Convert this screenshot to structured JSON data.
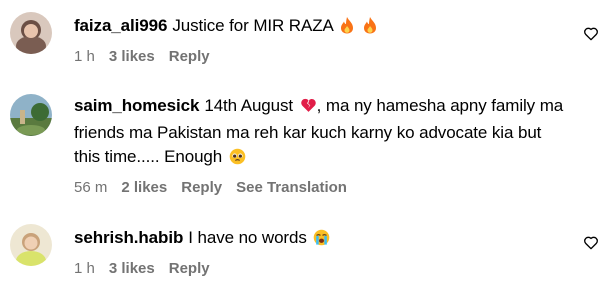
{
  "comments": [
    {
      "username": "faiza_ali996",
      "text": "Justice for MIR RAZA",
      "emojis": [
        "fire-emoji",
        "fire-emoji"
      ],
      "time": "1 h",
      "likes": "3 likes",
      "reply": "Reply"
    },
    {
      "username": "saim_homesick",
      "text_part1": "14th August",
      "text_part2": ", ma ny hamesha apny family ma friends ma Pakistan ma reh kar kuch karny ko advocate kia but this time..... Enough",
      "emojis": [
        "broken-heart-emoji",
        "pleading-face-emoji"
      ],
      "time": "56 m",
      "likes": "2 likes",
      "reply": "Reply",
      "translate": "See Translation"
    },
    {
      "username": "sehrish.habib",
      "text": "I have no words",
      "emojis": [
        "crying-face-emoji"
      ],
      "time": "1 h",
      "likes": "3 likes",
      "reply": "Reply"
    }
  ],
  "icons": {
    "like": "heart-outline-icon"
  },
  "colors": {
    "meta_text": "#737373",
    "fire": "#f97316",
    "broken_heart": "#e11d48"
  }
}
